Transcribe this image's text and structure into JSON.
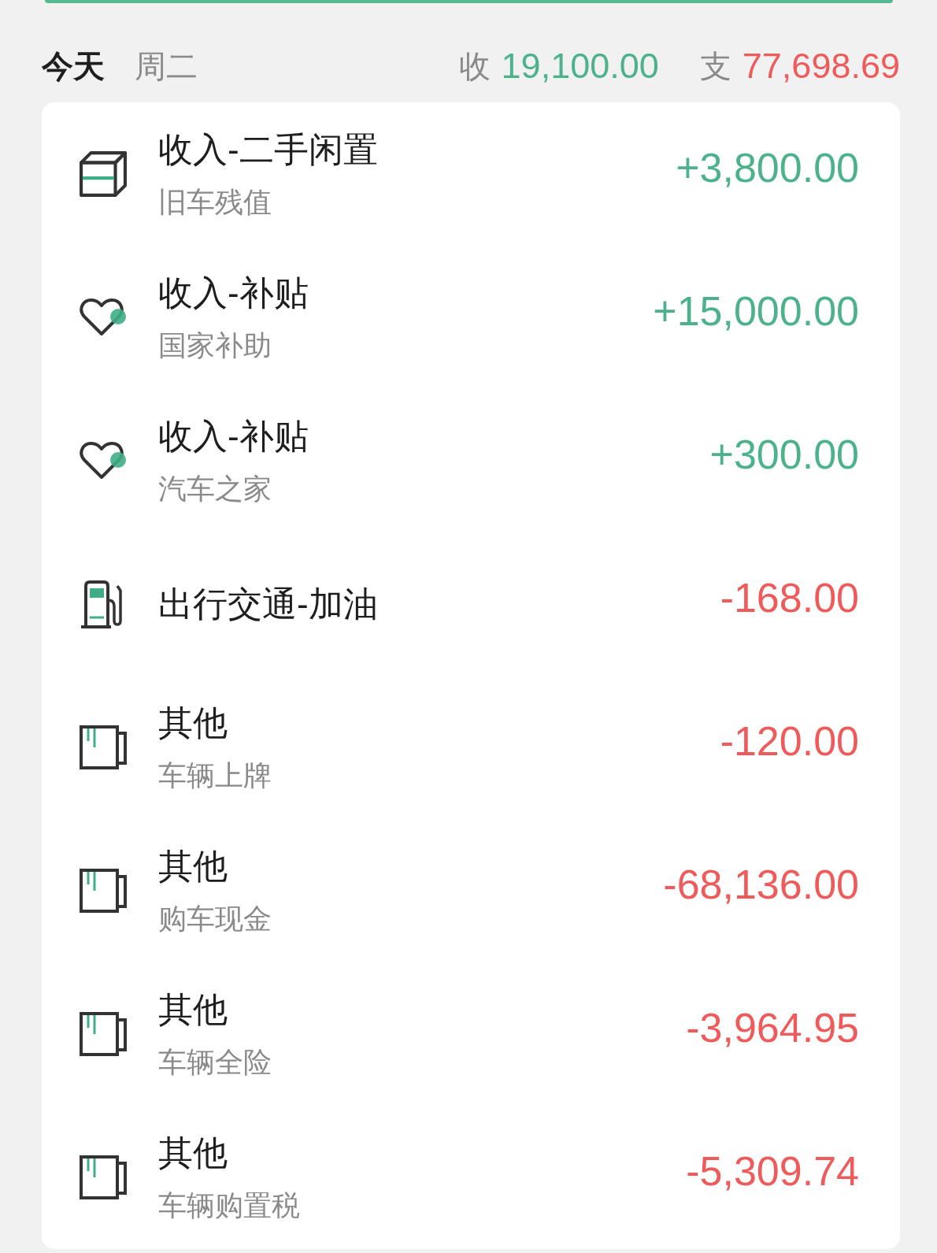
{
  "day_header": {
    "day": "今天",
    "weekday": "周二",
    "income_label": "收",
    "income_total": "19,100.00",
    "expense_label": "支",
    "expense_total": "77,698.69"
  },
  "entries": [
    {
      "kind": "resale",
      "color": "#4cb28b",
      "category": "收入-二手闲置",
      "note": "旧车残值",
      "amount": "+3,800.00"
    },
    {
      "kind": "subsidy",
      "color": "#4cb28b",
      "category": "收入-补贴",
      "note": "国家补助",
      "amount": "+15,000.00"
    },
    {
      "kind": "subsidy",
      "color": "#4cb28b",
      "category": "收入-补贴",
      "note": "汽车之家",
      "amount": "+300.00"
    },
    {
      "kind": "fuel",
      "color": "#ef5b5b",
      "category": "出行交通-加油",
      "amount": "-168.00"
    },
    {
      "kind": "other",
      "color": "#ef5b5b",
      "category": "其他",
      "note": "车辆上牌",
      "amount": "-120.00"
    },
    {
      "kind": "other",
      "color": "#ef5b5b",
      "category": "其他",
      "note": "购车现金",
      "amount": "-68,136.00"
    },
    {
      "kind": "other",
      "color": "#ef5b5b",
      "category": "其他",
      "note": "车辆全险",
      "amount": "-3,964.95"
    },
    {
      "kind": "other",
      "color": "#ef5b5b",
      "category": "其他",
      "note": "车辆购置税",
      "amount": "-5,309.74"
    }
  ]
}
